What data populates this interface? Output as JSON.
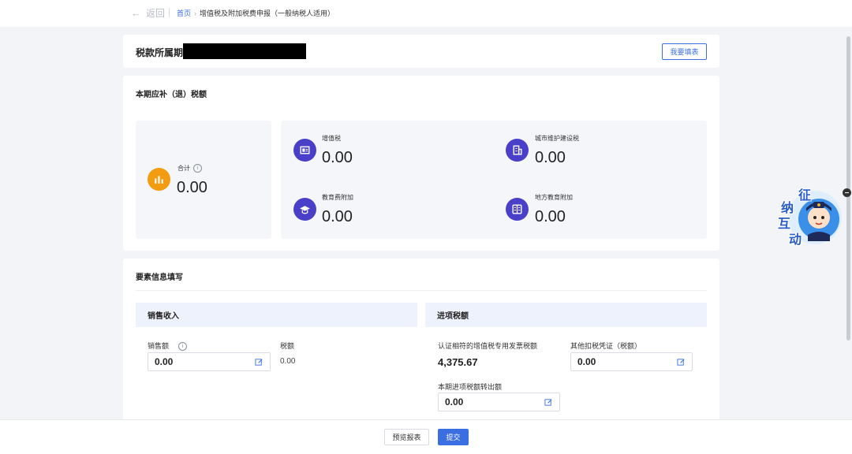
{
  "header": {
    "back_label": "返回",
    "breadcrumb_home": "首页",
    "breadcrumb_current": "增值税及附加税费申报（一般纳税人适用）"
  },
  "period": {
    "label": "税款所属期",
    "fill_button": "我要填表"
  },
  "tax_summary": {
    "title": "本期应补（退）税额",
    "total_label": "合计",
    "total_value": "0.00",
    "items": [
      {
        "label": "增值税",
        "value": "0.00",
        "icon": "invoice-icon"
      },
      {
        "label": "城市维护建设税",
        "value": "0.00",
        "icon": "building-icon"
      },
      {
        "label": "教育费附加",
        "value": "0.00",
        "icon": "graduation-cap-icon"
      },
      {
        "label": "地方教育附加",
        "value": "0.00",
        "icon": "book-icon"
      }
    ]
  },
  "elements": {
    "title": "要素信息填写",
    "sales": {
      "heading": "销售收入",
      "amount_label": "销售额",
      "amount_value": "0.00",
      "tax_label": "税额",
      "tax_value": "0.00"
    },
    "input_tax": {
      "heading": "进项税额",
      "certified_label": "认证相符的增值税专用发票税额",
      "certified_value": "4,375.67",
      "other_label": "其他扣税凭证（税额）",
      "other_value": "0.00",
      "transfer_label": "本期进项税额转出额",
      "transfer_value": "0.00"
    }
  },
  "footer": {
    "preview_button": "预览报表",
    "submit_button": "提交"
  },
  "mascot": {
    "chars": [
      "征",
      "纳",
      "互",
      "动"
    ]
  },
  "colors": {
    "accent": "#3b6ee0",
    "icon_purple": "#4a3fc9",
    "icon_orange": "#f39c12"
  }
}
